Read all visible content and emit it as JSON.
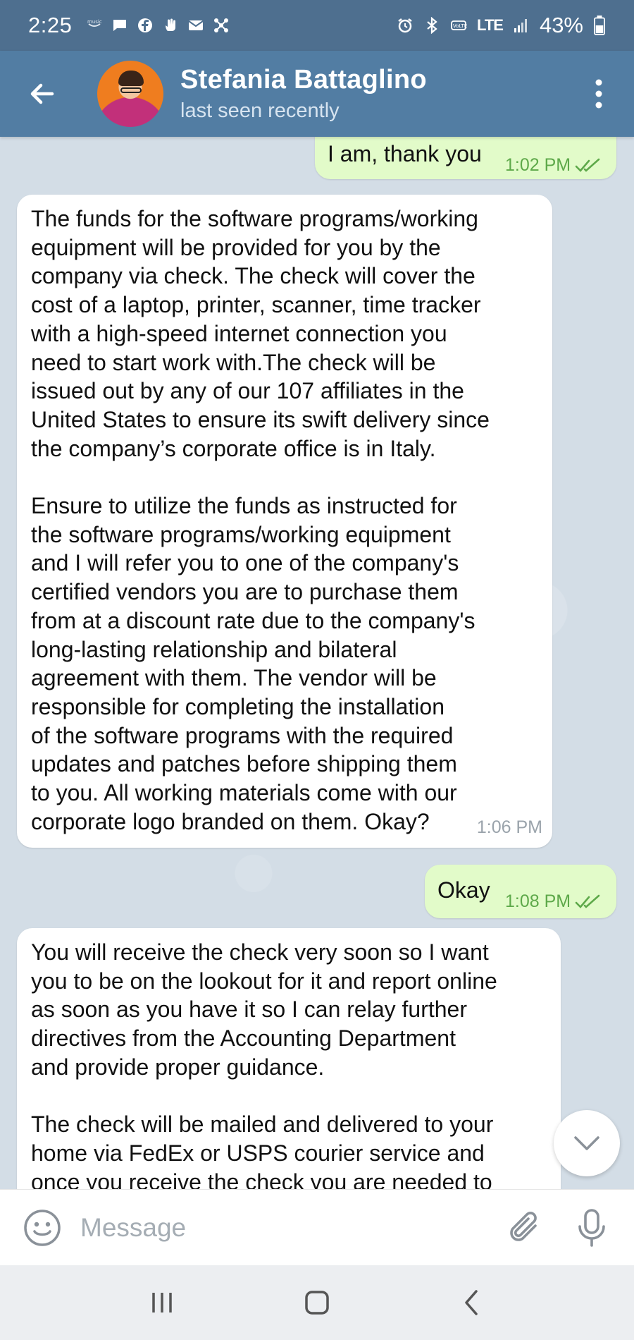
{
  "status_bar": {
    "time": "2:25",
    "left_icons": [
      "music-icon",
      "chat-icon",
      "facebook-icon",
      "hand-icon",
      "mail-icon",
      "network-icon"
    ],
    "network": "LTE",
    "battery": "43%"
  },
  "header": {
    "name": "Stefania Battaglino",
    "status": "last seen recently"
  },
  "messages": [
    {
      "direction": "out",
      "text": "I am, thank you",
      "time": "1:02 PM",
      "read": true
    },
    {
      "direction": "in",
      "text": "The funds for the software programs/working\nequipment will be provided for you by the\ncompany via check. The check will cover the\ncost of a laptop, printer, scanner, time tracker\nwith a high-speed internet connection you\nneed to start work with.The check will be\nissued out by any of our 107 affiliates in the\nUnited States to ensure its swift delivery since\nthe company’s corporate office is in Italy.\n\nEnsure to utilize the funds as instructed for\nthe software programs/working equipment\nand I will refer you to one of the company's\ncertified vendors you are to purchase them\nfrom at a discount rate due to the company's\nlong-lasting relationship and bilateral\nagreement with them. The vendor will be\nresponsible for completing the installation\nof the software programs with the required\nupdates and patches before shipping them\nto you. All working materials come with our\ncorporate logo branded on them. Okay?",
      "time": "1:06 PM"
    },
    {
      "direction": "out",
      "text": "Okay",
      "time": "1:08 PM",
      "read": true
    },
    {
      "direction": "in",
      "text": "You will receive the check very soon so I want\nyou to be on the lookout for it and report online\nas soon as you have it so I can relay further\ndirectives from the Accounting Department\nand provide proper guidance.\n\nThe check will be mailed and delivered to your\nhome via FedEx or USPS courier service and\nonce you receive the check you are needed to"
    }
  ],
  "input": {
    "placeholder": "Message",
    "value": ""
  },
  "colors": {
    "status_bar": "#4e6f8f",
    "header": "#527da3",
    "outgoing_bubble": "#e2fbc9",
    "incoming_bubble": "#ffffff",
    "outgoing_time": "#5ea94a",
    "chat_background": "#d3dde6"
  }
}
